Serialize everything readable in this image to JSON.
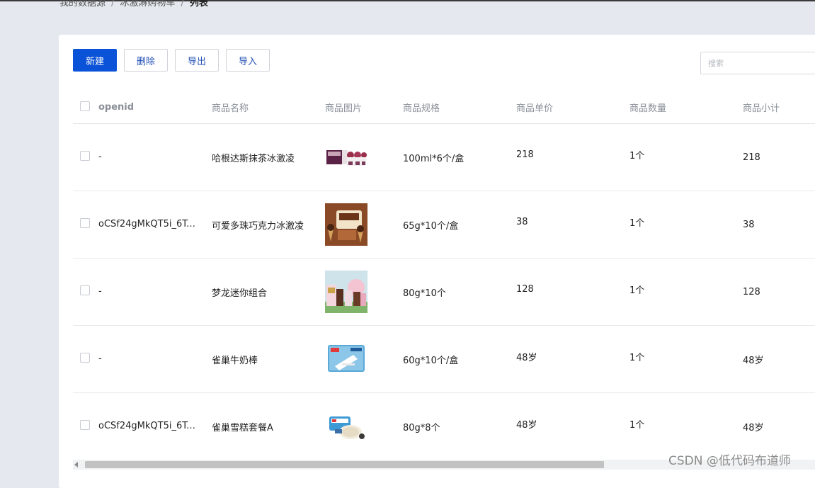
{
  "breadcrumb": {
    "items": [
      "我的数据源",
      "冰激淋购物车"
    ],
    "current": "列表",
    "separator": "/"
  },
  "toolbar": {
    "new_label": "新建",
    "delete_label": "删除",
    "export_label": "导出",
    "import_label": "导入"
  },
  "search": {
    "placeholder": "搜索",
    "value": ""
  },
  "table": {
    "headers": {
      "openid": "openid",
      "name": "商品名称",
      "image": "商品图片",
      "spec": "商品规格",
      "price": "商品单价",
      "qty": "商品数量",
      "subtotal": "商品小计"
    },
    "rows": [
      {
        "openid": "-",
        "name": "哈根达斯抹茶冰激凌",
        "image": "haagen-dazs-box-image",
        "spec": "100ml*6个/盒",
        "price": "218",
        "qty": "1个",
        "subtotal": "218"
      },
      {
        "openid": "oCSf24gMkQT5i_6Ts…",
        "name": "可爱多珠巧克力冰激凌",
        "image": "cornetto-box-image",
        "spec": "65g*10个/盒",
        "price": "38",
        "qty": "1个",
        "subtotal": "38"
      },
      {
        "openid": "-",
        "name": "梦龙迷你组合",
        "image": "magnum-mini-image",
        "spec": "80g*10个",
        "price": "128",
        "qty": "1个",
        "subtotal": "128"
      },
      {
        "openid": "-",
        "name": "雀巢牛奶棒",
        "image": "nestle-milk-bar-image",
        "spec": "60g*10个/盒",
        "price": "48岁",
        "qty": "1个",
        "subtotal": "48岁"
      },
      {
        "openid": "oCSf24gMkQT5i_6Ts…",
        "name": "雀巢雪糕套餐A",
        "image": "nestle-combo-image",
        "spec": "80g*8个",
        "price": "48岁",
        "qty": "1个",
        "subtotal": "48岁"
      }
    ]
  },
  "colors": {
    "primary": "#0a52d8",
    "link": "#1f4fb5",
    "background": "#e5e8ee"
  },
  "watermark": "CSDN @低代码布道师"
}
